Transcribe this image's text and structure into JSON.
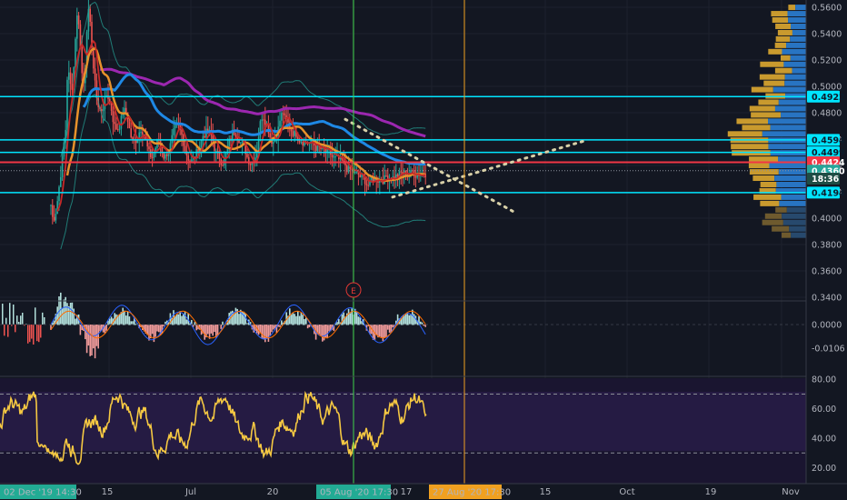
{
  "chart_data": [
    {
      "type": "candlestick",
      "panel": "price",
      "ylim": [
        0.334,
        0.57
      ],
      "yticks": [
        "0.5600",
        "0.5400",
        "0.5200",
        "0.5000",
        "0.4800",
        "0.4600",
        "0.4400",
        "0.4200",
        "0.4000",
        "0.3800",
        "0.3600",
        "0.3400"
      ],
      "ytick_values": [
        0.56,
        0.54,
        0.52,
        0.5,
        0.48,
        0.46,
        0.44,
        0.42,
        0.4,
        0.38,
        0.36,
        0.34
      ],
      "price_labels": [
        {
          "value": 0.4922,
          "text": "0.4922",
          "color": "#00e5ff",
          "text_color": "#0d1b2a"
        },
        {
          "value": 0.4594,
          "text": "0.4594",
          "color": "#00e5ff",
          "text_color": "#0d1b2a"
        },
        {
          "value": 0.4499,
          "text": "0.4499",
          "color": "#00e5ff",
          "text_color": "#0d1b2a"
        },
        {
          "value": 0.4424,
          "text": "0.4424",
          "color": "#f23645",
          "text_color": "#ffffff"
        },
        {
          "value": 0.436,
          "text": "0.4360",
          "color": "#26a69a",
          "text_color": "#ffffff"
        },
        {
          "value": 0.43,
          "text": "18:36",
          "color": "#1e4d45",
          "text_color": "#ffffff"
        },
        {
          "value": 0.4194,
          "text": "0.4194",
          "color": "#00e5ff",
          "text_color": "#0d1b2a"
        }
      ],
      "horizontal_lines": [
        {
          "value": 0.4922,
          "color": "#00e5ff"
        },
        {
          "value": 0.4594,
          "color": "#00e5ff"
        },
        {
          "value": 0.4499,
          "color": "#00e5ff"
        },
        {
          "value": 0.4424,
          "color": "#f23645"
        },
        {
          "value": 0.4194,
          "color": "#00e5ff"
        }
      ],
      "event_marker": "E",
      "colors": {
        "up": "#26a69a",
        "down": "#ef5350",
        "ma_fast": "#c62828",
        "ma_mid": "#e8922b",
        "ma_slow": "#1e88e5",
        "ma_long": "#9c27b0",
        "bands": "#26a69a"
      }
    },
    {
      "type": "line",
      "panel": "macd",
      "yticks": [
        "0.0000",
        "-0.0106"
      ],
      "ytick_values": [
        0.0,
        -0.0106
      ],
      "series": [
        {
          "color": "#2962ff"
        },
        {
          "color": "#ff6d00"
        }
      ]
    },
    {
      "type": "line",
      "panel": "rsi",
      "ylim": [
        12,
        82
      ],
      "yticks": [
        "80.00",
        "60.00",
        "40.00",
        "20.00"
      ],
      "ytick_values": [
        80,
        60,
        40,
        20
      ],
      "bands": [
        30,
        70
      ],
      "series": [
        {
          "color": "#f5c842"
        }
      ]
    }
  ],
  "xaxis": {
    "ticks": [
      "15",
      "Jul",
      "20",
      "17",
      "15",
      "Oct",
      "19",
      "Nov"
    ],
    "highlight_left": "02 Dec '19  14:30",
    "highlight_mid": "05 Aug '20  17:30",
    "highlight_cursor": "27 Aug '20  17:30",
    "colors": {
      "left": "#22ab94",
      "mid": "#22ab94",
      "cursor": "#f0a020"
    }
  }
}
